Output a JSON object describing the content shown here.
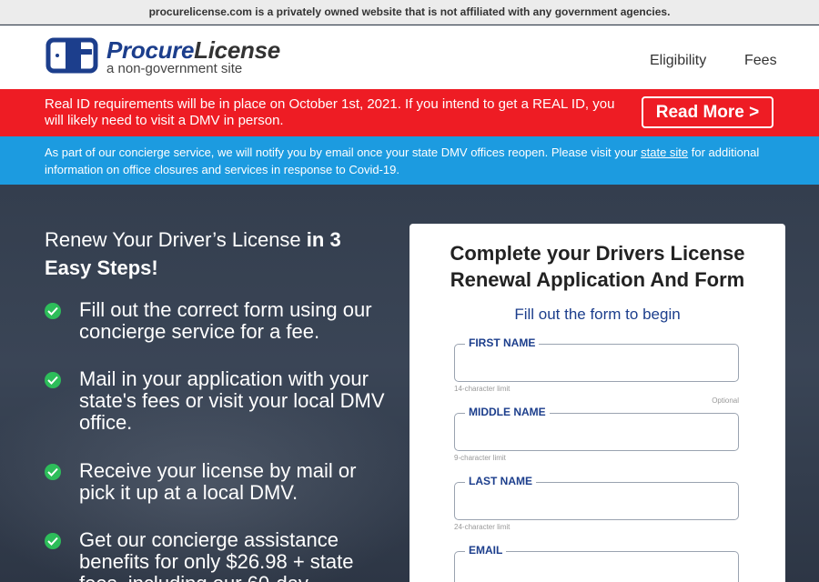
{
  "disclaimer": "procurelicense.com is a privately owned website that is not affiliated with any government agencies.",
  "header": {
    "logo_name_part1": "Procure",
    "logo_name_part2": "License",
    "logo_tagline": "a non-government site",
    "nav": [
      "Eligibility",
      "Fees"
    ]
  },
  "red_banner": {
    "text": "Real ID requirements will be in place on October 1st, 2021. If you intend to get a REAL ID, you will likely need to visit a DMV in person.",
    "button": "Read More >",
    "color": "#ee1c24"
  },
  "blue_banner": {
    "text_before": "As part of our concierge service, we will notify you by email once your state DMV offices reopen. Please visit your ",
    "link": "state site",
    "text_after": " for additional information on office closures and services in response to Covid-19.",
    "color": "#1c9be0"
  },
  "hero": {
    "title_normal": "Renew Your Driver’s License ",
    "title_bold": "in 3 Easy Steps!",
    "steps": [
      "Fill out the correct form using our concierge service for a fee.",
      "Mail in your application with your state's fees or visit your local DMV office.",
      "Receive your license by mail or pick it up at a local DMV.",
      "Get our concierge assistance benefits for only $26.98 + state fees, including our 60-day"
    ]
  },
  "form": {
    "title": "Complete your Drivers License Renewal Application And Form",
    "subtitle": "Fill out the form to begin",
    "fields": [
      {
        "label": "FIRST NAME",
        "hint": "14-character limit",
        "optional": "",
        "value": ""
      },
      {
        "label": "MIDDLE NAME",
        "hint": "9-character limit",
        "optional": "Optional",
        "value": ""
      },
      {
        "label": "LAST NAME",
        "hint": "24-character limit",
        "optional": "",
        "value": ""
      },
      {
        "label": "EMAIL",
        "hint": "",
        "optional": "",
        "value": ""
      }
    ]
  },
  "colors": {
    "brand": "#1c3e8c",
    "check": "#2dbd5a"
  }
}
